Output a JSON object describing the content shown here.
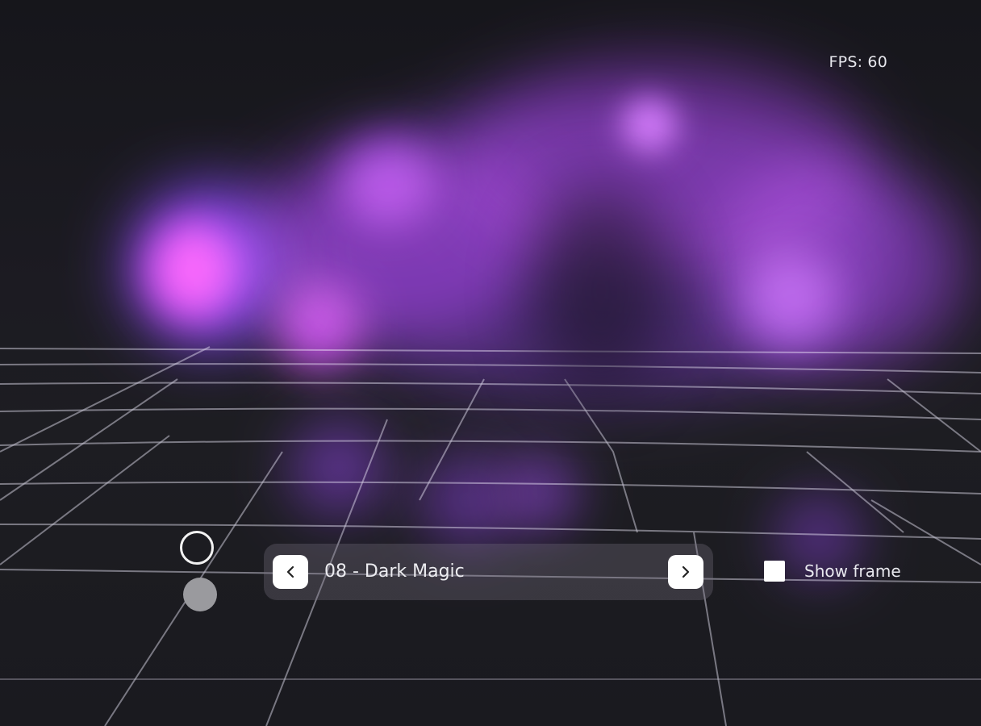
{
  "stats": {
    "fps": "FPS: 60"
  },
  "swatches": [
    {
      "name": "white-outline",
      "color": "#ffffff",
      "selected": true
    },
    {
      "name": "gray",
      "color": "#9a9a9e",
      "selected": false
    }
  ],
  "preset_selector": {
    "current": "08 - Dark Magic",
    "prev_icon": "chevron-left-icon",
    "next_icon": "chevron-right-icon"
  },
  "show_frame": {
    "label": "Show frame",
    "checked": false
  },
  "colors": {
    "background": "#1b1b20",
    "magic_purple": "#8a2cf0",
    "magic_magenta": "#ff2ee6",
    "grid_line": "#c9c6d6"
  }
}
